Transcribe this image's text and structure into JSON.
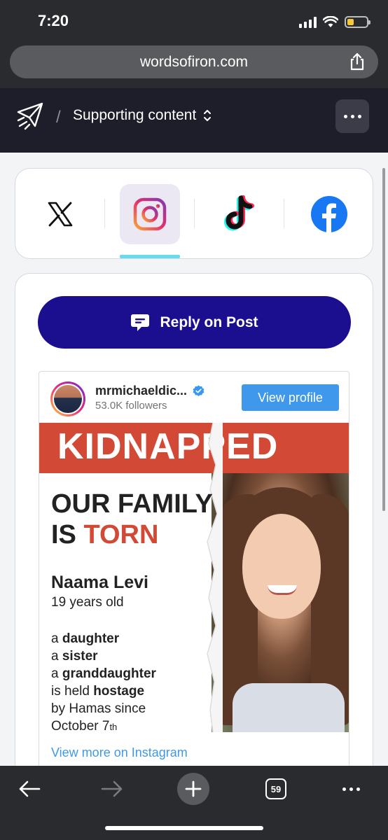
{
  "status_bar": {
    "time": "7:20",
    "icons": [
      "signal-icon",
      "wifi-icon",
      "battery-icon"
    ]
  },
  "browser": {
    "url": "wordsofiron.com",
    "share_icon": "share-icon",
    "open_tabs": "59"
  },
  "header": {
    "logo_icon": "paper-plane-icon",
    "separator": "/",
    "title": "Supporting content",
    "menu_icon": "more-dots-icon"
  },
  "platform_tabs": [
    {
      "id": "x",
      "icon": "x-logo-icon",
      "active": false
    },
    {
      "id": "instagram",
      "icon": "instagram-logo-icon",
      "active": true
    },
    {
      "id": "tiktok",
      "icon": "tiktok-logo-icon",
      "active": false
    },
    {
      "id": "facebook",
      "icon": "facebook-logo-icon",
      "active": false
    }
  ],
  "reply_button": {
    "label": "Reply on Post",
    "icon": "comment-icon"
  },
  "embed": {
    "handle": "mrmichaeldic...",
    "followers": "53.0K followers",
    "view_profile": "View profile",
    "view_more": "View more on Instagram",
    "post": {
      "banner": "KIDNAPPED",
      "headline_1": "OUR FAMILY",
      "headline_2_prefix": "IS ",
      "headline_2_red": "TORN",
      "name": "Naama Levi",
      "age": "19 years old",
      "line_a": "a ",
      "line_daughter": "daughter",
      "line_sister": "sister",
      "line_granddaughter": "granddaughter",
      "line_held_prefix": "is held ",
      "line_hostage": "hostage",
      "line_by": "by Hamas since",
      "line_oct": "October 7",
      "line_th": "th"
    }
  },
  "colors": {
    "accent": "#1b0f8f",
    "kidnapped_red": "#d24a35",
    "instagram_blue": "#4098ed",
    "tab_underline": "#69dcec"
  }
}
